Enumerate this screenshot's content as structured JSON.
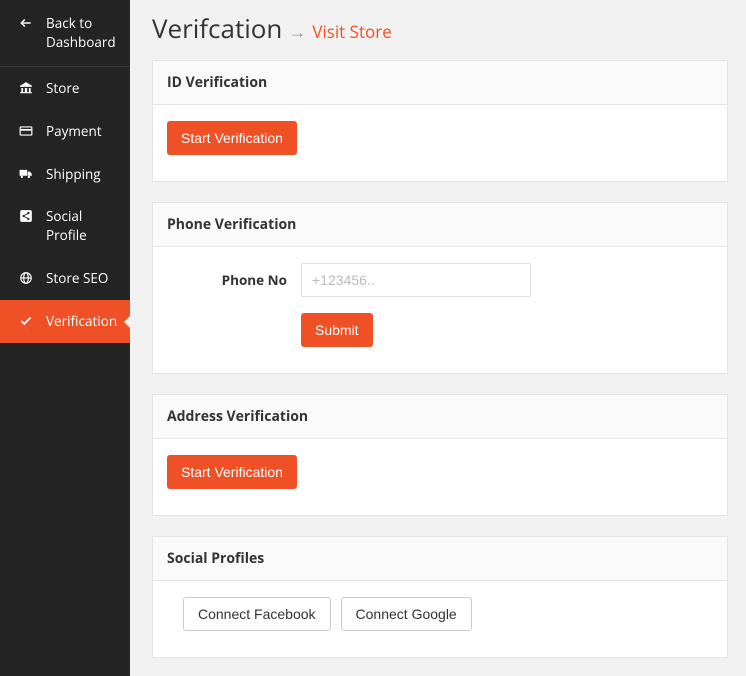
{
  "sidebar": {
    "back": {
      "label": "Back to Dashboard"
    },
    "items": [
      {
        "label": "Store"
      },
      {
        "label": "Payment"
      },
      {
        "label": "Shipping"
      },
      {
        "label": "Social Profile"
      },
      {
        "label": "Store SEO"
      },
      {
        "label": "Verification"
      }
    ]
  },
  "page": {
    "title": "Verifcation",
    "arrow": "→",
    "visit_link": "Visit Store"
  },
  "panels": {
    "id_verification": {
      "header": "ID Verification",
      "button": "Start Verification"
    },
    "phone_verification": {
      "header": "Phone Verification",
      "label": "Phone No",
      "placeholder": "+123456..",
      "submit": "Submit"
    },
    "address_verification": {
      "header": "Address Verification",
      "button": "Start Verification"
    },
    "social_profiles": {
      "header": "Social Profiles",
      "facebook": "Connect Facebook",
      "google": "Connect Google"
    }
  }
}
